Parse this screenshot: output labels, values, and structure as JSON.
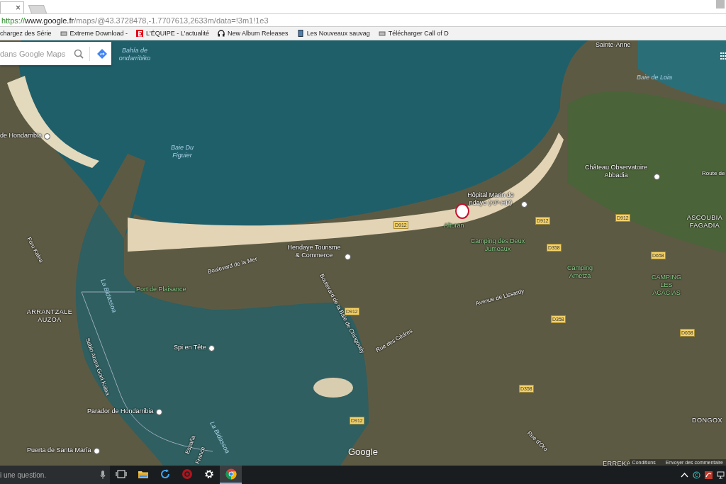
{
  "browser": {
    "tabs": [
      {
        "selected": true,
        "close": "×"
      },
      {
        "selected": false
      }
    ],
    "address": {
      "scheme": "https://",
      "host": "www.google.fr",
      "path": "/maps/@43.3728478,-1.7707613,2633m/data=!3m1!1e3"
    },
    "bookmarks": [
      "chargez des Série",
      "Extreme Download -",
      "L'ÉQUIPE - L'actualité",
      "New Album Releases",
      "Les Nouveaux sauvag",
      "Télécharger Call of D"
    ]
  },
  "map": {
    "search": {
      "placeholder": "dans Google Maps"
    },
    "labels": [
      {
        "text": "Bahía de ondarribiko",
        "kind": "water"
      },
      {
        "text": "Sainte-Anne",
        "kind": "place"
      },
      {
        "text": "Baie de Loia",
        "kind": "water"
      },
      {
        "text": "de Hondarribia",
        "kind": "poi"
      },
      {
        "text": "Baie Du Figuier",
        "kind": "water"
      },
      {
        "text": "Château Observatoire Abbadia",
        "kind": "poi"
      },
      {
        "text": "Route de",
        "kind": "road"
      },
      {
        "text": "Hôpital Marin de ndaye (AP-HP)",
        "kind": "poi"
      },
      {
        "text": "Alturan",
        "kind": "green"
      },
      {
        "text": "Camping des Deux Jumeaux",
        "kind": "green"
      },
      {
        "text": "ASCOUBIA FAGADIA",
        "kind": "district"
      },
      {
        "text": "Hendaye Tourisme & Commerce",
        "kind": "poi"
      },
      {
        "text": "Boulevard de la Mer",
        "kind": "road"
      },
      {
        "text": "Camping Ametza",
        "kind": "green"
      },
      {
        "text": "CAMPING LES ACACIAS",
        "kind": "green"
      },
      {
        "text": "Foru Kalea",
        "kind": "road"
      },
      {
        "text": "Port de Plaisance",
        "kind": "green"
      },
      {
        "text": "La Bidassoa",
        "kind": "water"
      },
      {
        "text": "ARRANTZALE AUZOA",
        "kind": "district"
      },
      {
        "text": "Boulevard de la Baie de Chingoudy",
        "kind": "road"
      },
      {
        "text": "Avenue de Lissardy",
        "kind": "road"
      },
      {
        "text": "Rue des Cèdres",
        "kind": "road"
      },
      {
        "text": "Spi en Tête",
        "kind": "poi"
      },
      {
        "text": "Sabin Arana Goiri Kalea",
        "kind": "road"
      },
      {
        "text": "Parador de Hondarribia",
        "kind": "poi"
      },
      {
        "text": "Puerta de Santa María",
        "kind": "poi"
      },
      {
        "text": "España",
        "kind": "road"
      },
      {
        "text": "France",
        "kind": "road"
      },
      {
        "text": "La Bidassoa",
        "kind": "water"
      },
      {
        "text": "Rue d'Oro",
        "kind": "road"
      },
      {
        "text": "DONGOX",
        "kind": "district"
      },
      {
        "text": "ERREKA",
        "kind": "district"
      }
    ],
    "shields": [
      "D912",
      "D912",
      "D912",
      "D358",
      "D658",
      "D912",
      "D358",
      "D658",
      "D358",
      "D912"
    ],
    "logo": "Google",
    "footer": [
      "Conditions",
      "Envoyer des commentaire"
    ]
  },
  "taskbar": {
    "search_placeholder": "i une question.",
    "apps": [
      {
        "kind": "taskview",
        "selected": false
      },
      {
        "kind": "folder",
        "selected": false
      },
      {
        "kind": "circle",
        "selected": false
      },
      {
        "kind": "target",
        "selected": false
      },
      {
        "kind": "gear",
        "selected": false
      },
      {
        "kind": "chrome",
        "selected": true
      }
    ]
  }
}
